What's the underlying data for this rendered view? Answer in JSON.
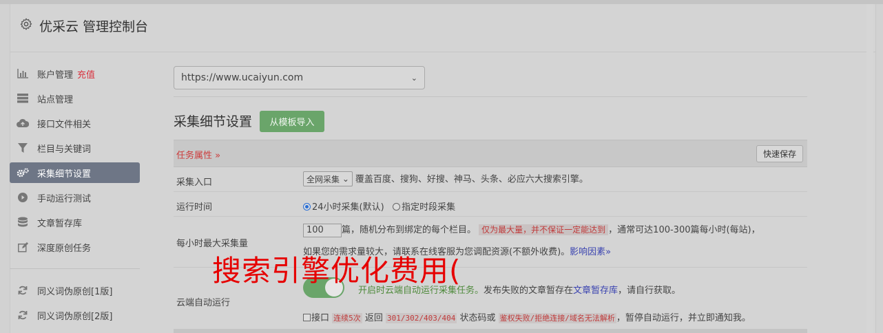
{
  "header": {
    "title": "优采云 管理控制台"
  },
  "sidebar": {
    "items": [
      {
        "label": "账户管理",
        "badge": "充值",
        "icon": "bar-chart-icon"
      },
      {
        "label": "站点管理",
        "icon": "server-icon"
      },
      {
        "label": "接口文件相关",
        "icon": "cloud-upload-icon"
      },
      {
        "label": "栏目与关键词",
        "icon": "filter-icon"
      },
      {
        "label": "采集细节设置",
        "icon": "gears-icon",
        "active": true
      },
      {
        "label": "手动运行测试",
        "icon": "play-circle-icon"
      },
      {
        "label": "文章暂存库",
        "icon": "database-icon"
      },
      {
        "label": "深度原创任务",
        "icon": "edit-icon"
      }
    ],
    "items2": [
      {
        "label": "同义词伪原创[1版]",
        "icon": "refresh-icon"
      },
      {
        "label": "同义词伪原创[2版]",
        "icon": "refresh-icon"
      }
    ]
  },
  "main": {
    "site_select_value": "https://www.ucaiyun.com",
    "section_title": "采集细节设置",
    "import_button": "从模板导入",
    "prop_bar_label": "任务属性 »",
    "save_button": "快速保存",
    "rows": {
      "entry": {
        "key": "采集入口",
        "select_value": "全网采集",
        "desc": "覆盖百度、搜狗、好搜、神马、头条、必应六大搜索引擎。"
      },
      "time": {
        "key": "运行时间",
        "option1": "24小时采集(默认)",
        "option2": "指定时段采集"
      },
      "max": {
        "key": "每小时最大采集量",
        "value": "100",
        "text1": "篇，随机分布到绑定的每个栏目。",
        "warn": "仅为最大量，并不保证一定能达到",
        "text2": "，通常可达100-300篇每小时(每站)，",
        "text3": "如果您的需求量较大，请联系在线客服为您调配资源(不额外收费)。",
        "link": "影响因素»"
      },
      "cloud": {
        "key": "云端自动运行",
        "green_text": "开启时云端自动运行采集任务。",
        "text1": "发布失败的文章暂存在",
        "link": "文章暂存库",
        "text2": "，请自行获取。",
        "cb_label": "接口",
        "code1": "连续5次",
        "text3": " 返回 ",
        "code2": "301/302/403/404",
        "text4": " 状态码或 ",
        "code3": "鉴权失败/拒绝连接/域名无法解析",
        "text5": "，暂停自动运行，并立即通知我。"
      }
    }
  },
  "overlay_text": "搜索引擎优化费用(",
  "colors": {
    "accent_red": "#d9333f",
    "green": "#6aa56a",
    "active_nav": "#6e7686",
    "overlay": "#e60000"
  }
}
